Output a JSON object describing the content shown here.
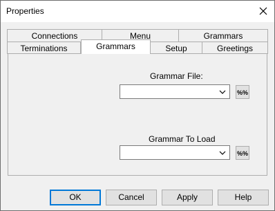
{
  "window": {
    "title": "Properties"
  },
  "tabs": {
    "row1": [
      "Connections",
      "Menu",
      "Grammars"
    ],
    "row2": [
      "Terminations",
      "Grammars",
      "Setup",
      "Greetings"
    ],
    "active": "Grammars"
  },
  "panel": {
    "grammar_file_label": "Grammar File:",
    "grammar_file_value": "",
    "grammar_to_load_label": "Grammar To Load",
    "grammar_to_load_value": ""
  },
  "buttons": {
    "ok": "OK",
    "cancel": "Cancel",
    "apply": "Apply",
    "help": "Help"
  },
  "icons": {
    "close": "close-icon",
    "dropdown": "chevron-down-icon",
    "variable": "percent-variable-icon"
  }
}
